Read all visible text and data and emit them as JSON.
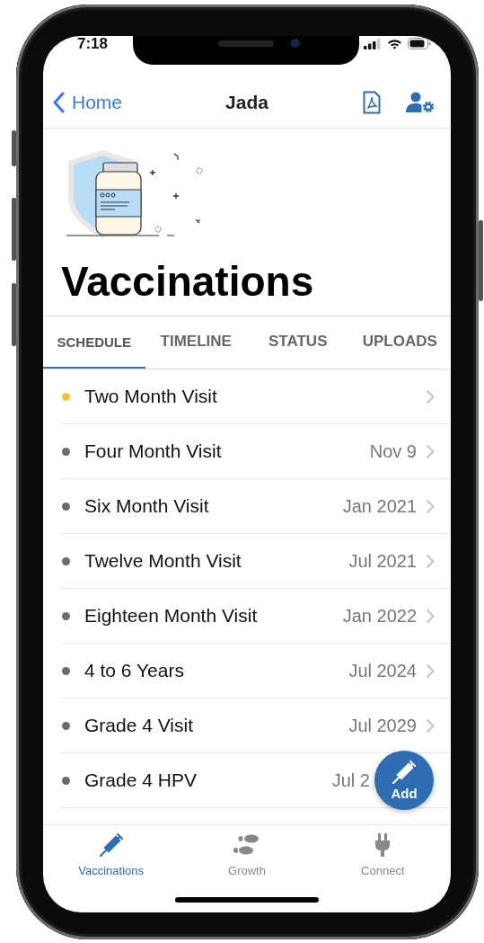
{
  "status_bar": {
    "time": "7:18"
  },
  "nav": {
    "back": "Home",
    "title": "Jada"
  },
  "page_title": "Vaccinations",
  "tabs": [
    {
      "label": "SCHEDULE",
      "selected": true
    },
    {
      "label": "TIMELINE",
      "selected": false
    },
    {
      "label": "STATUS",
      "selected": false
    },
    {
      "label": "UPLOADS",
      "selected": false
    }
  ],
  "visits": [
    {
      "name": "Two Month Visit",
      "color": "#f5c531",
      "chevron": true
    },
    {
      "name": "Four Month Visit",
      "date": "Nov 9",
      "color": "#6b6b6b",
      "chevron": true
    },
    {
      "name": "Six Month Visit",
      "date": "Jan 2021",
      "color": "#6b6b6b",
      "chevron": true
    },
    {
      "name": "Twelve Month Visit",
      "date": "Jul 2021",
      "color": "#6b6b6b",
      "chevron": true
    },
    {
      "name": "Eighteen Month Visit",
      "date": "Jan 2022",
      "color": "#6b6b6b",
      "chevron": true
    },
    {
      "name": "4 to 6 Years",
      "date": "Jul 2024",
      "color": "#6b6b6b",
      "chevron": true
    },
    {
      "name": "Grade 4 Visit",
      "date": "Jul 2029",
      "color": "#6b6b6b",
      "chevron": true
    },
    {
      "name": "Grade 4 HPV",
      "date": "Jul 2",
      "color": "#6b6b6b",
      "chevron": false
    }
  ],
  "add_button": {
    "label": "Add"
  },
  "bottom_tabs": [
    {
      "label": "Vaccinations",
      "selected": true,
      "kind": "syringe"
    },
    {
      "label": "Growth",
      "selected": false,
      "kind": "footprints"
    },
    {
      "label": "Connect",
      "selected": false,
      "kind": "plug"
    }
  ]
}
